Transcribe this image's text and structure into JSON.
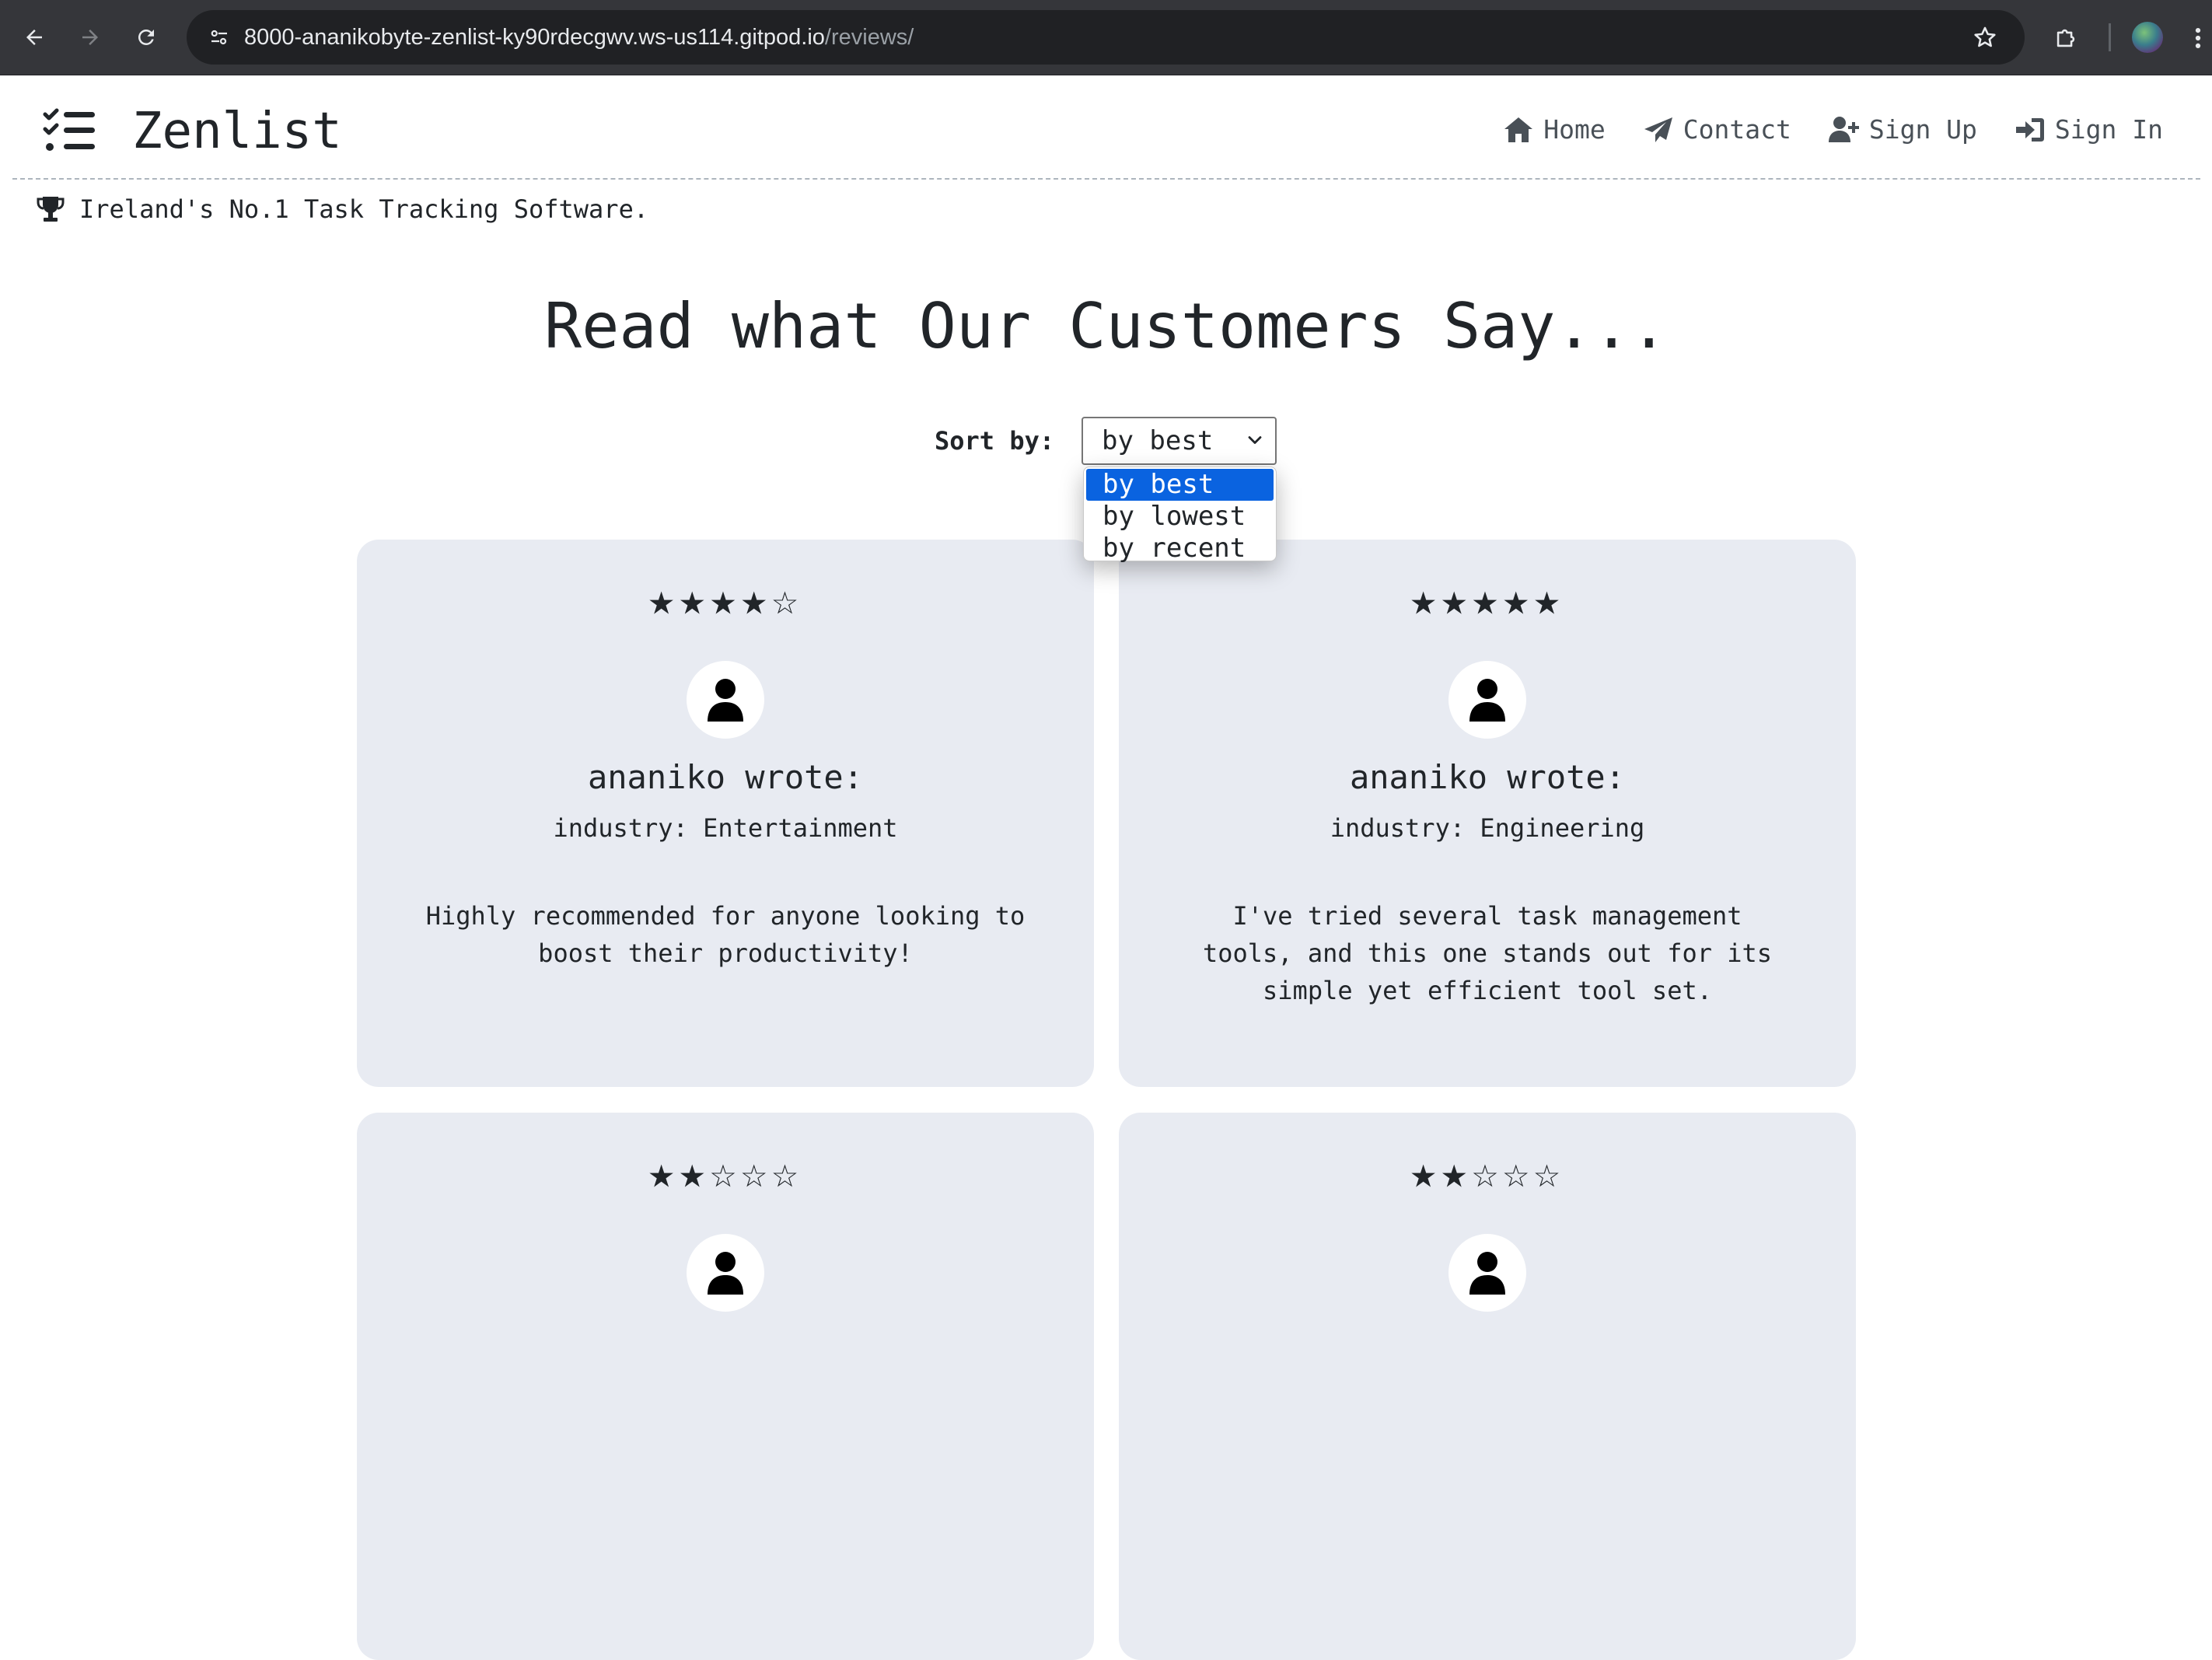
{
  "browser": {
    "url_host": "8000-ananikobyte-zenlist-ky90rdecgwv.ws-us114.gitpod.io",
    "url_path": "/reviews/"
  },
  "header": {
    "brand": "Zenlist",
    "nav": [
      {
        "label": "Home",
        "icon": "home-icon"
      },
      {
        "label": "Contact",
        "icon": "paper-plane-icon"
      },
      {
        "label": "Sign Up",
        "icon": "user-plus-icon"
      },
      {
        "label": "Sign In",
        "icon": "sign-in-icon"
      }
    ]
  },
  "tagline": "Ireland's No.1 Task Tracking Software.",
  "main": {
    "title": "Read what Our Customers Say...",
    "sort": {
      "label": "Sort by:",
      "selected": "by best",
      "options": [
        "by best",
        "by lowest",
        "by recent"
      ]
    },
    "reviews": [
      {
        "stars": "★★★★☆",
        "rating": 4,
        "author": "ananiko wrote:",
        "industry": "industry: Entertainment",
        "text": "Highly recommended for anyone looking to boost their productivity!"
      },
      {
        "stars": "★★★★★",
        "rating": 5,
        "author": "ananiko wrote:",
        "industry": "industry: Engineering",
        "text": "I've tried several task management tools, and this one stands out for its simple yet efficient tool set."
      },
      {
        "stars": "★★☆☆☆",
        "rating": 2,
        "author": "",
        "industry": "",
        "text": ""
      },
      {
        "stars": "★★☆☆☆",
        "rating": 2,
        "author": "",
        "industry": "",
        "text": ""
      }
    ]
  },
  "colors": {
    "card_bg": "#e8ebf2",
    "option_highlight": "#0a63e0",
    "chrome_bg": "#35363a"
  }
}
